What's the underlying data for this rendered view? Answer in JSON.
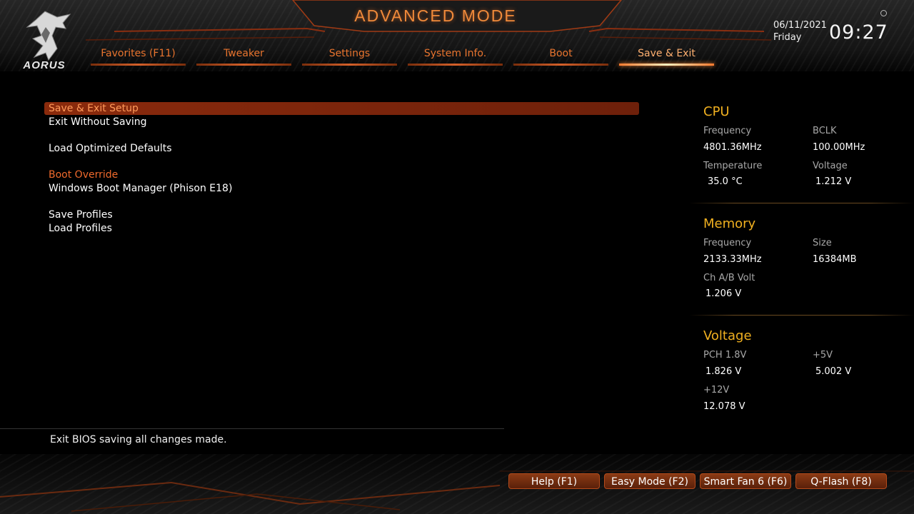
{
  "header": {
    "mode_title": "ADVANCED MODE",
    "logo_text": "AORUS",
    "date": "06/11/2021",
    "day": "Friday",
    "time": "09:27"
  },
  "tabs": [
    {
      "label": "Favorites (F11)",
      "active": false
    },
    {
      "label": "Tweaker",
      "active": false
    },
    {
      "label": "Settings",
      "active": false
    },
    {
      "label": "System Info.",
      "active": false
    },
    {
      "label": "Boot",
      "active": false
    },
    {
      "label": "Save & Exit",
      "active": true
    }
  ],
  "menu": {
    "save_exit_setup": "Save & Exit Setup",
    "exit_without_saving": "Exit Without Saving",
    "load_optimized_defaults": "Load Optimized Defaults",
    "boot_override_heading": "Boot Override",
    "boot_entry": "Windows Boot Manager (Phison E18)",
    "save_profiles": "Save Profiles",
    "load_profiles": "Load Profiles"
  },
  "help_text": "Exit BIOS saving all changes made.",
  "panel": {
    "cpu": {
      "title": "CPU",
      "frequency_label": "Frequency",
      "frequency": "4801.36MHz",
      "bclk_label": "BCLK",
      "bclk": "100.00MHz",
      "temperature_label": "Temperature",
      "temperature": "35.0 °C",
      "voltage_label": "Voltage",
      "voltage": "1.212 V"
    },
    "memory": {
      "title": "Memory",
      "frequency_label": "Frequency",
      "frequency": "2133.33MHz",
      "size_label": "Size",
      "size": "16384MB",
      "chab_label": "Ch A/B Volt",
      "chab": "1.206 V"
    },
    "voltage": {
      "title": "Voltage",
      "pch_label": "PCH 1.8V",
      "pch": "1.826 V",
      "v5_label": "+5V",
      "v5": "5.002 V",
      "v12_label": "+12V",
      "v12": "12.078 V"
    }
  },
  "footer_buttons": {
    "help": "Help (F1)",
    "easy_mode": "Easy Mode (F2)",
    "smart_fan": "Smart Fan 6 (F6)",
    "qflash": "Q-Flash (F8)"
  },
  "colors": {
    "accent": "#e8742e",
    "selected_bg": "#8a2a0c",
    "section_title": "#f0b020"
  }
}
